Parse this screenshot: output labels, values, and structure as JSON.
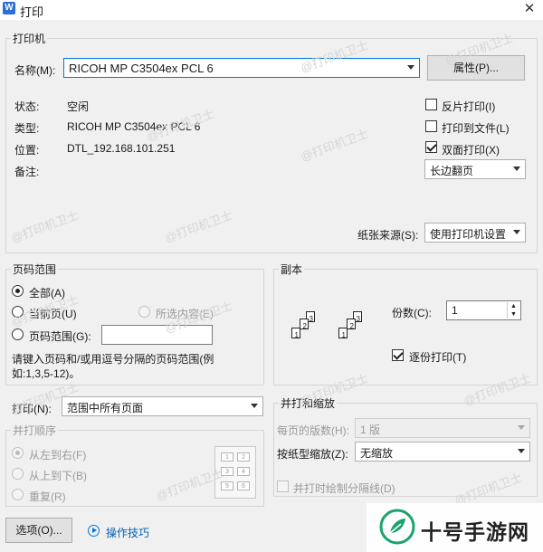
{
  "window": {
    "title": "打印",
    "app_icon_letter": "W"
  },
  "printer": {
    "group_label": "打印机",
    "name_label": "名称(M):",
    "name_value": "RICOH MP C3504ex PCL 6",
    "properties_button": "属性(P)...",
    "status_label": "状态:",
    "status_value": "空闲",
    "type_label": "类型:",
    "type_value": "RICOH MP C3504ex PCL 6",
    "location_label": "位置:",
    "location_value": "DTL_192.168.101.251",
    "comment_label": "备注:",
    "reverse_print": {
      "label": "反片打印(I)",
      "checked": false
    },
    "print_to_file": {
      "label": "打印到文件(L)",
      "checked": false
    },
    "duplex": {
      "label": "双面打印(X)",
      "checked": true
    },
    "flip_value": "长边翻页",
    "paper_source_label": "纸张来源(S):",
    "paper_source_value": "使用打印机设置"
  },
  "page_range": {
    "group_label": "页码范围",
    "all": "全部(A)",
    "current": "当前页(U)",
    "selection": "所选内容(E)",
    "pages": "页码范围(G):",
    "pages_value": "",
    "hint": "请键入页码和/或用逗号分隔的页码范围(例如:1,3,5-12)。"
  },
  "copies": {
    "group_label": "副本",
    "count_label": "份数(C):",
    "count_value": "1",
    "collate_label": "逐份打印(T)",
    "collate_checked": true
  },
  "print_what": {
    "label": "打印(N):",
    "value": "范围中所有页面"
  },
  "order": {
    "group_label": "并打顺序",
    "left_to_right": "从左到右(F)",
    "top_to_bottom": "从上到下(B)",
    "repeat": "重复(R)",
    "mini_pages": [
      "1",
      "2",
      "3",
      "4",
      "5",
      "6"
    ]
  },
  "zoom": {
    "group_label": "并打和缩放",
    "pages_per_sheet_label": "每页的版数(H):",
    "pages_per_sheet_value": "1 版",
    "scale_label": "按纸型缩放(Z):",
    "scale_value": "无缩放",
    "draw_borders_label": "并打时绘制分隔线(D)"
  },
  "footer": {
    "options_button": "选项(O)...",
    "tips_link": "操作技巧",
    "tips_icon": "play-circle-icon"
  },
  "watermark": {
    "text": "@打印机卫士",
    "brand_text": "十号手游网",
    "brand_icon": "leaf-logo-icon"
  },
  "colors": {
    "accent": "#0078d7",
    "brand_green": "#1aa36b"
  }
}
